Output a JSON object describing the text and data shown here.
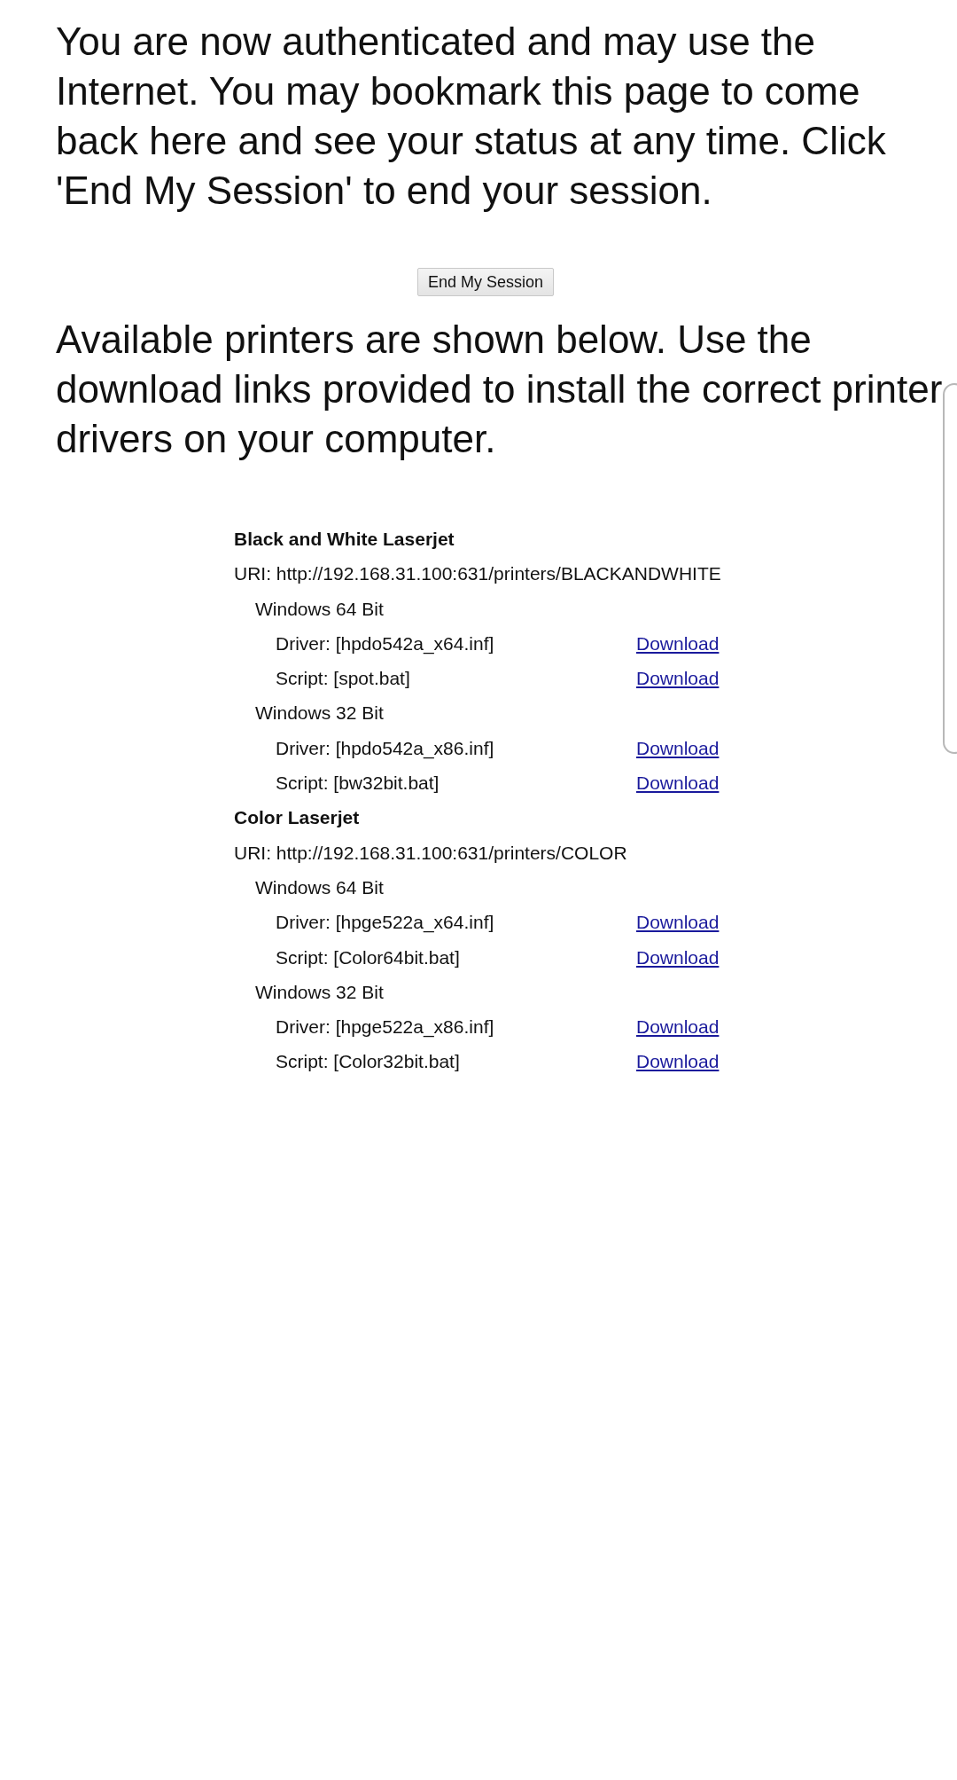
{
  "intro": "You are now authenticated and may use the Internet. You may bookmark this page to come back here and see your status at any time. Click 'End My Session' to end your session.",
  "end_button": "End My Session",
  "printers_intro": "Available printers are shown below. Use the download links provided to install the correct printer drivers on your computer.",
  "printers": [
    {
      "name": "Black and White Laserjet",
      "uri": "URI: http://192.168.31.100:631/printers/BLACKANDWHITE",
      "platforms": [
        {
          "name": "Windows 64 Bit",
          "files": [
            {
              "label": "Driver: [hpdo542a_x64.inf]",
              "link": "Download"
            },
            {
              "label": "Script: [spot.bat]",
              "link": "Download"
            }
          ]
        },
        {
          "name": "Windows 32 Bit",
          "files": [
            {
              "label": "Driver: [hpdo542a_x86.inf]",
              "link": "Download"
            },
            {
              "label": "Script: [bw32bit.bat]",
              "link": "Download"
            }
          ]
        }
      ]
    },
    {
      "name": "Color Laserjet",
      "uri": "URI: http://192.168.31.100:631/printers/COLOR",
      "platforms": [
        {
          "name": "Windows 64 Bit",
          "files": [
            {
              "label": "Driver: [hpge522a_x64.inf]",
              "link": "Download"
            },
            {
              "label": "Script: [Color64bit.bat]",
              "link": "Download"
            }
          ]
        },
        {
          "name": "Windows 32 Bit",
          "files": [
            {
              "label": "Driver: [hpge522a_x86.inf]",
              "link": "Download"
            },
            {
              "label": "Script: [Color32bit.bat]",
              "link": "Download"
            }
          ]
        }
      ]
    }
  ]
}
